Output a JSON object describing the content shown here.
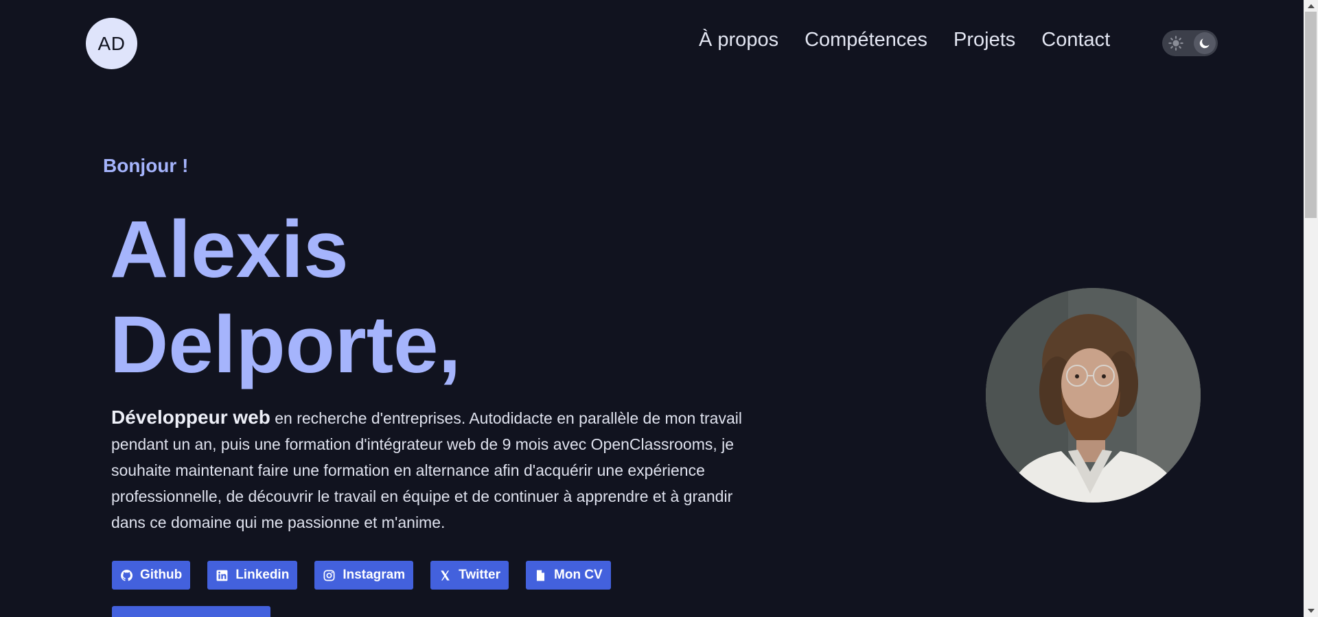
{
  "header": {
    "logo_text": "AD",
    "nav": [
      "À propos",
      "Compétences",
      "Projets",
      "Contact"
    ],
    "theme_toggle": {
      "icons": [
        "sun-icon",
        "moon-icon"
      ],
      "state": "dark"
    }
  },
  "hero": {
    "greeting": "Bonjour !",
    "name_line1": "Alexis",
    "name_line2": "Delporte,",
    "bio_lead": "Développeur web",
    "bio_text": " en recherche d'entreprises. Autodidacte en parallèle de mon travail pendant un an, puis une formation d'intégrateur web de 9 mois avec OpenClassrooms, je souhaite maintenant faire une formation en alternance afin d'acquérir une expérience professionnelle, de découvrir le travail en équipe et de continuer à apprendre et à grandir dans ce domaine qui me passionne et m'anime.",
    "socials": [
      {
        "label": "Github",
        "icon": "github-icon"
      },
      {
        "label": "Linkedin",
        "icon": "linkedin-icon"
      },
      {
        "label": "Instagram",
        "icon": "instagram-icon"
      },
      {
        "label": "Twitter",
        "icon": "x-icon"
      },
      {
        "label": "Mon CV",
        "icon": "file-icon"
      }
    ]
  },
  "colors": {
    "background": "#11131f",
    "accent": "#a5b4fc",
    "button": "#4361dd"
  }
}
